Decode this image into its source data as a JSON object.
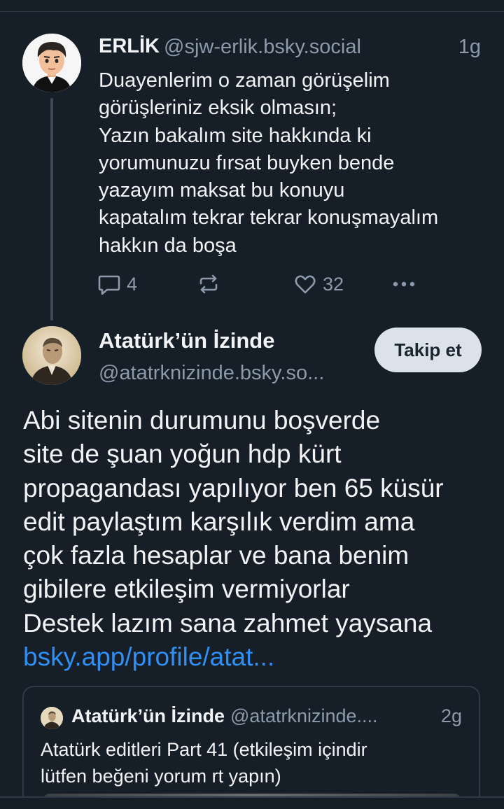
{
  "parent_post": {
    "author_name": "ERLİK",
    "handle": "@sjw-erlik.bsky.social",
    "time": "1g",
    "text_lines": [
      "Duayenlerim o zaman görüşelim",
      "görüşleriniz eksik olmasın;",
      "Yazın bakalım site hakkında ki",
      "yorumunuzu fırsat buyken bende",
      "yazayım maksat bu konuyu",
      "kapatalım tekrar tekrar konuşmayalım",
      "hakkın da boşa"
    ],
    "actions": {
      "reply_count": "4",
      "like_count": "32",
      "icons": [
        "reply-icon",
        "repost-icon",
        "like-icon",
        "more-icon"
      ]
    }
  },
  "main_post": {
    "author_name": "Atatürk’ün İzinde",
    "handle": "@atatrknizinde.bsky.so...",
    "follow_label": "Takip et",
    "text_lines": [
      "Abi sitenin durumunu boşverde",
      "site de şuan yoğun hdp kürt",
      "propagandası yapılıyor ben 65 küsür",
      "edit paylaştım karşılık verdim ama",
      "çok fazla hesaplar ve bana benim",
      "gibilere etkileşim vermiyorlar",
      "Destek lazım sana zahmet yaysana"
    ],
    "link": "bsky.app/profile/atat..."
  },
  "quote_post": {
    "author_name": "Atatürk’ün İzinde",
    "handle": "@atatrknizinde....",
    "time": "2g",
    "text_lines": [
      "Atatürk editleri Part 41 (etkileşim içindir",
      "lütfen beğeni yorum rt yapın)"
    ]
  },
  "colors": {
    "background": "#161e27",
    "link": "#2f8ff5",
    "muted": "#8c9aab",
    "follow_button": "#dce2ea"
  }
}
